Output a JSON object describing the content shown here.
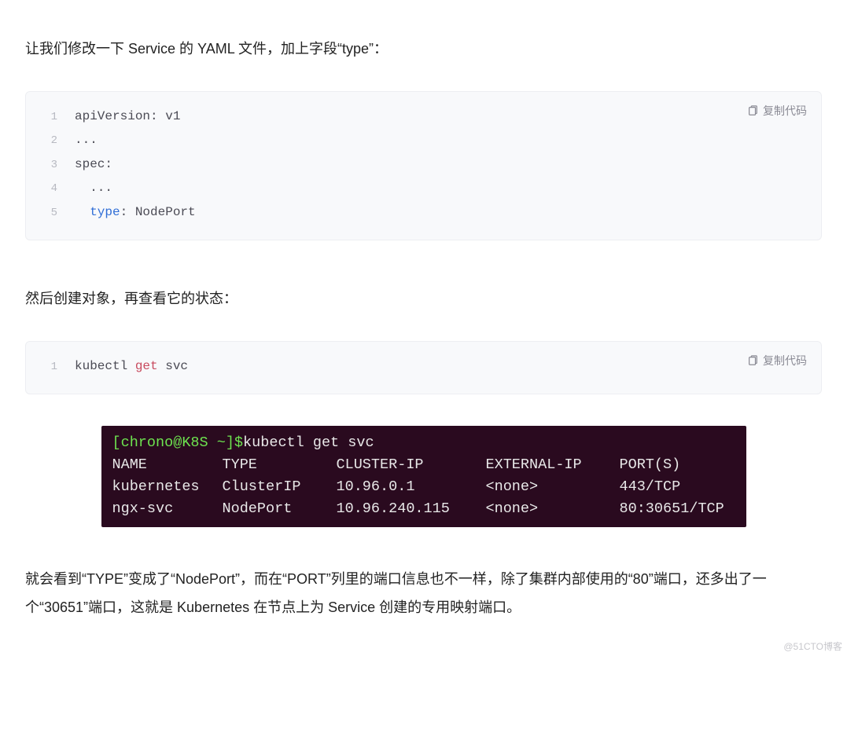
{
  "para1": "让我们修改一下 Service 的 YAML 文件，加上字段“type”：",
  "copyLabel": "复制代码",
  "code1": {
    "l1": "apiVersion: v1",
    "l2": "...",
    "l3": "spec:",
    "l4": "  ...",
    "l5a": "  ",
    "l5b": "type",
    "l5c": ": NodePort"
  },
  "para2": "然后创建对象，再查看它的状态：",
  "code2": {
    "l1a": "kubectl ",
    "l1b": "get",
    "l1c": " svc"
  },
  "terminal": {
    "prompt": "[chrono@K8S ~]$",
    "cmd": "kubectl get svc",
    "headers": {
      "name": "NAME",
      "type": "TYPE",
      "cip": "CLUSTER-IP",
      "eip": "EXTERNAL-IP",
      "ports": "PORT(S)"
    },
    "rows": [
      {
        "name": "kubernetes",
        "type": "ClusterIP",
        "cip": "10.96.0.1",
        "eip": "<none>",
        "ports": "443/TCP"
      },
      {
        "name": "ngx-svc",
        "type": "NodePort",
        "cip": "10.96.240.115",
        "eip": "<none>",
        "ports": "80:30651/TCP"
      }
    ]
  },
  "para3": "就会看到“TYPE”变成了“NodePort”，而在“PORT”列里的端口信息也不一样，除了集群内部使用的“80”端口，还多出了一个“30651”端口，这就是 Kubernetes 在节点上为 Service 创建的专用映射端口。",
  "watermark": "@51CTO博客",
  "chart_data": {
    "type": "table",
    "title": "kubectl get svc output",
    "headers": [
      "NAME",
      "TYPE",
      "CLUSTER-IP",
      "EXTERNAL-IP",
      "PORT(S)"
    ],
    "rows": [
      [
        "kubernetes",
        "ClusterIP",
        "10.96.0.1",
        "<none>",
        "443/TCP"
      ],
      [
        "ngx-svc",
        "NodePort",
        "10.96.240.115",
        "<none>",
        "80:30651/TCP"
      ]
    ]
  }
}
